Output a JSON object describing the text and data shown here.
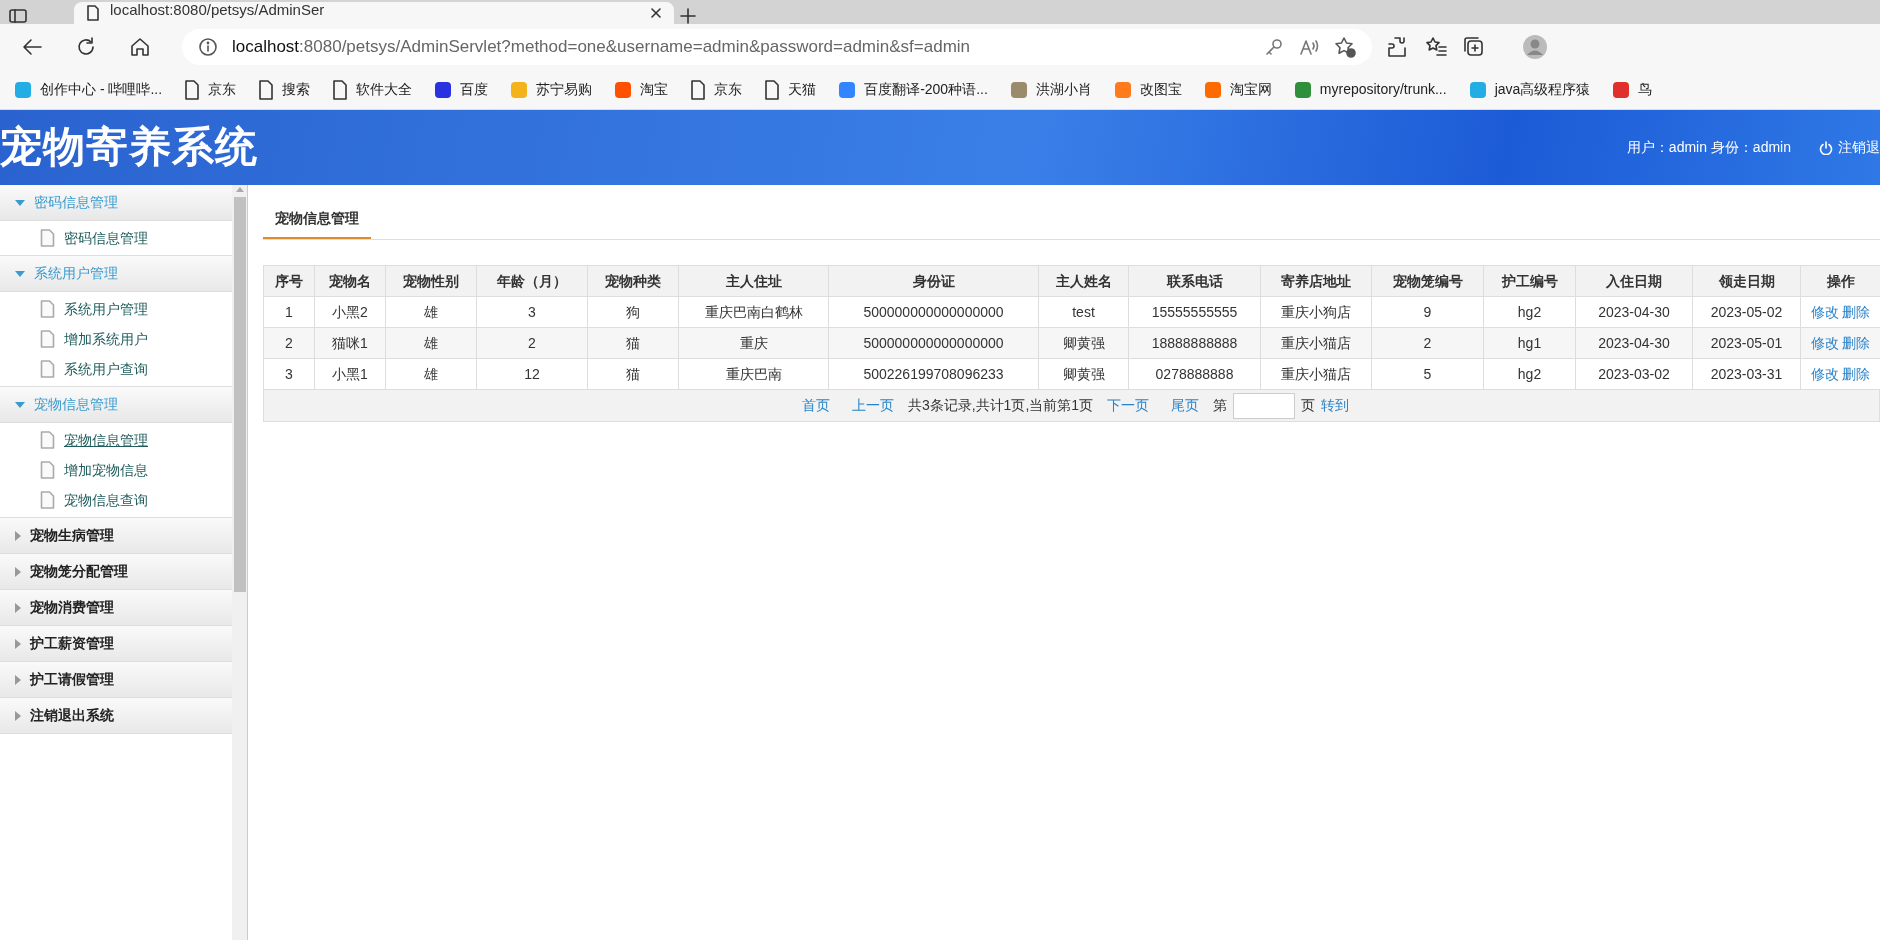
{
  "browser": {
    "tab_title": "localhost:8080/petsys/AdminSer",
    "address": {
      "host": "localhost",
      "rest": ":8080/petsys/AdminServlet?method=one&username=admin&password=admin&sf=admin"
    },
    "bookmarks": [
      {
        "label": "创作中心 - 哔哩哔...",
        "kind": "site",
        "color": "#23ade5"
      },
      {
        "label": "京东",
        "kind": "page"
      },
      {
        "label": "搜索",
        "kind": "page"
      },
      {
        "label": "软件大全",
        "kind": "page"
      },
      {
        "label": "百度",
        "kind": "site",
        "color": "#2932e1"
      },
      {
        "label": "苏宁易购",
        "kind": "site",
        "color": "#f5b31a"
      },
      {
        "label": "淘宝",
        "kind": "site",
        "color": "#ff5000"
      },
      {
        "label": "京东",
        "kind": "page"
      },
      {
        "label": "天猫",
        "kind": "page"
      },
      {
        "label": "百度翻译-200种语...",
        "kind": "site",
        "color": "#3385ff"
      },
      {
        "label": "洪湖小肖",
        "kind": "site",
        "color": "#9a8c6a"
      },
      {
        "label": "改图宝",
        "kind": "site",
        "color": "#ff7a1a"
      },
      {
        "label": "淘宝网",
        "kind": "site",
        "color": "#ff6a00"
      },
      {
        "label": "myrepository/trunk...",
        "kind": "site",
        "color": "#2f8f3a"
      },
      {
        "label": "java高级程序猿",
        "kind": "site",
        "color": "#23ade5"
      },
      {
        "label": "鸟",
        "kind": "site",
        "color": "#e0302b"
      }
    ]
  },
  "header": {
    "title": "宠物寄养系统",
    "user_info": "用户：admin 身份：admin",
    "logout": "注销退"
  },
  "sidebar": {
    "groups": [
      {
        "label": "密码信息管理",
        "expanded": true,
        "children": [
          {
            "label": "密码信息管理",
            "selected": false
          }
        ]
      },
      {
        "label": "系统用户管理",
        "expanded": true,
        "children": [
          {
            "label": "系统用户管理",
            "selected": false
          },
          {
            "label": "增加系统用户",
            "selected": false
          },
          {
            "label": "系统用户查询",
            "selected": false
          }
        ]
      },
      {
        "label": "宠物信息管理",
        "expanded": true,
        "children": [
          {
            "label": "宠物信息管理",
            "selected": true
          },
          {
            "label": "增加宠物信息",
            "selected": false
          },
          {
            "label": "宠物信息查询",
            "selected": false
          }
        ]
      },
      {
        "label": "宠物生病管理",
        "expanded": false
      },
      {
        "label": "宠物笼分配管理",
        "expanded": false
      },
      {
        "label": "宠物消费管理",
        "expanded": false
      },
      {
        "label": "护工薪资管理",
        "expanded": false
      },
      {
        "label": "护工请假管理",
        "expanded": false
      },
      {
        "label": "注销退出系统",
        "expanded": false
      }
    ]
  },
  "tabs": [
    {
      "label": "宠物信息管理",
      "selected": true
    }
  ],
  "table": {
    "columns": [
      "序号",
      "宠物名",
      "宠物性别",
      "年龄（月）",
      "宠物种类",
      "主人住址",
      "身份证",
      "主人姓名",
      "联系电话",
      "寄养店地址",
      "宠物笼编号",
      "护工编号",
      "入住日期",
      "领走日期",
      "操作"
    ],
    "rows": [
      {
        "cells": [
          "1",
          "小黑2",
          "雄",
          "3",
          "狗",
          "重庆巴南白鹤林",
          "500000000000000000",
          "test",
          "15555555555",
          "重庆小狗店",
          "9",
          "hg2",
          "2023-04-30",
          "2023-05-02"
        ],
        "actions": [
          "修改",
          "删除"
        ]
      },
      {
        "cells": [
          "2",
          "猫咪1",
          "雄",
          "2",
          "猫",
          "重庆",
          "500000000000000000",
          "卿黄强",
          "18888888888",
          "重庆小猫店",
          "2",
          "hg1",
          "2023-04-30",
          "2023-05-01"
        ],
        "actions": [
          "修改",
          "删除"
        ]
      },
      {
        "cells": [
          "3",
          "小黑1",
          "雄",
          "12",
          "猫",
          "重庆巴南",
          "500226199708096233",
          "卿黄强",
          "0278888888",
          "重庆小猫店",
          "5",
          "hg2",
          "2023-03-02",
          "2023-03-31"
        ],
        "actions": [
          "修改",
          "删除"
        ]
      }
    ]
  },
  "pagination": {
    "first": "首页",
    "prev": "上一页",
    "summary": "共3条记录,共计1页,当前第1页",
    "next": "下一页",
    "last": "尾页",
    "page_prefix": "第",
    "page_suffix": "页",
    "go": "转到"
  }
}
